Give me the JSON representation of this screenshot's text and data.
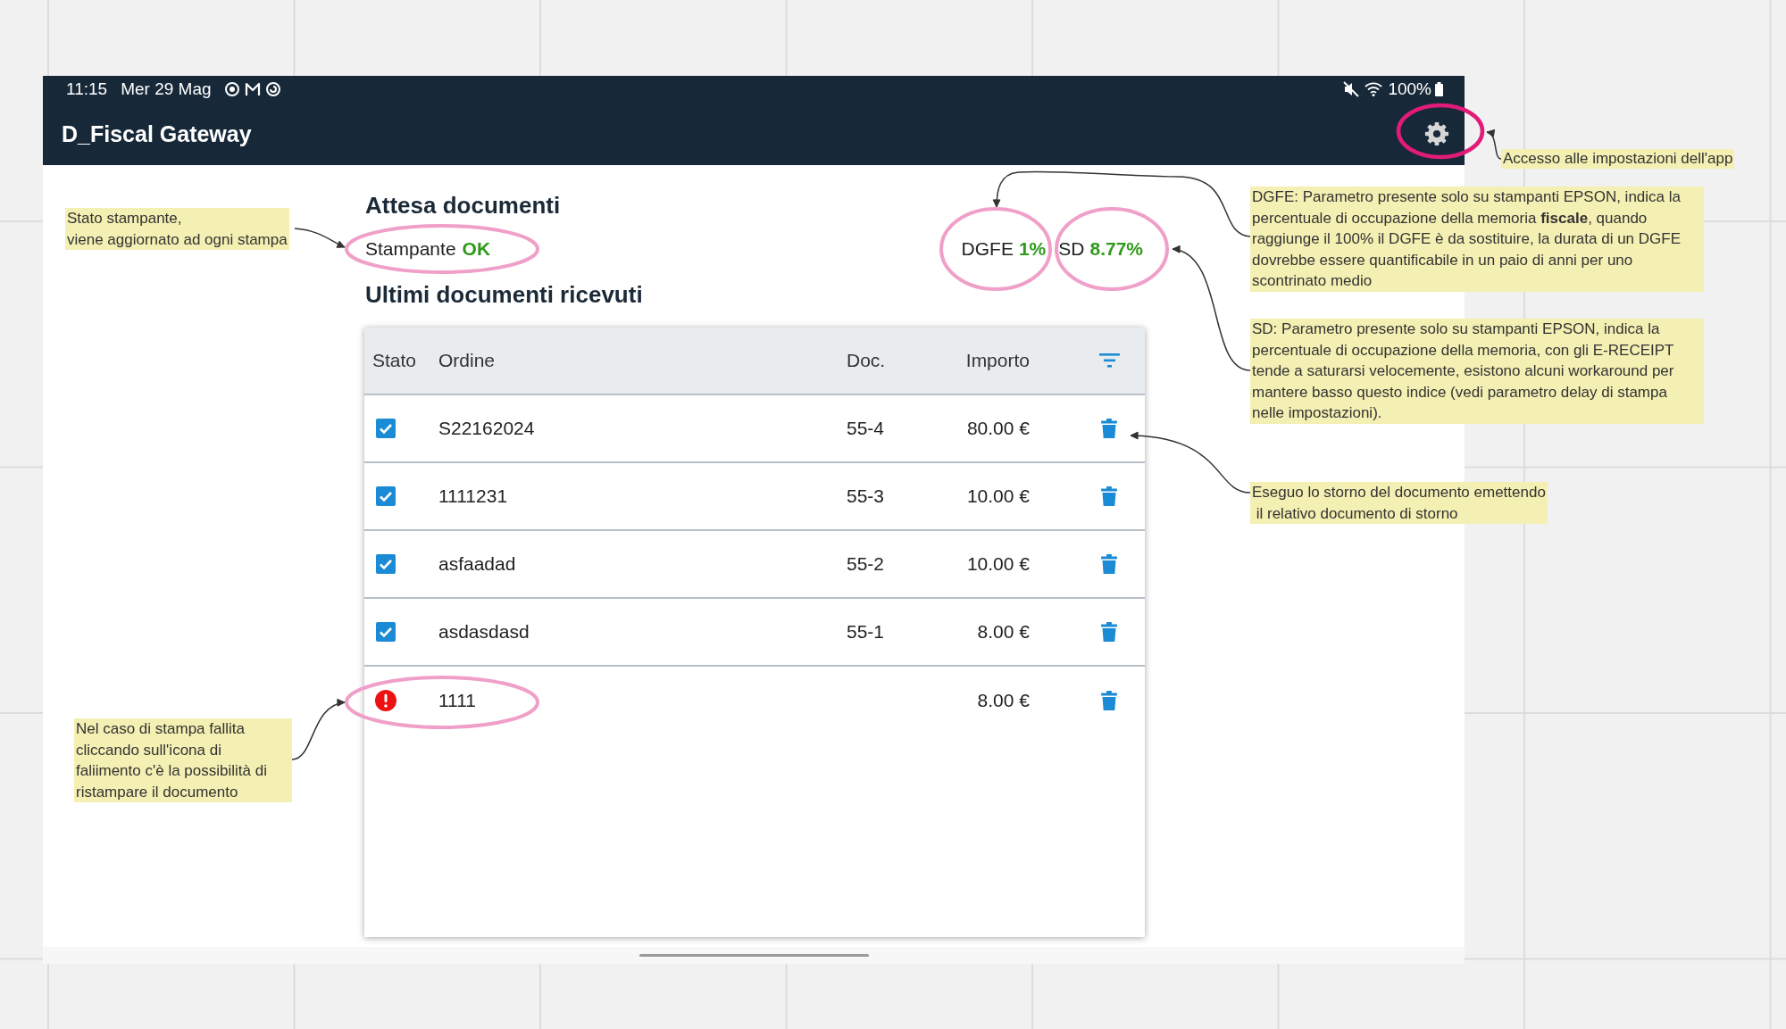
{
  "status_bar": {
    "time": "11:15",
    "date": "Mer 29 Mag",
    "battery": "100%"
  },
  "app_bar": {
    "title": "D_Fiscal Gateway"
  },
  "status_panel": {
    "heading": "Attesa documenti",
    "printer_label": "Stampante",
    "printer_status": "OK",
    "dgfe_label": "DGFE",
    "dgfe_value": "1%",
    "sd_label": "SD",
    "sd_value": "8.77%"
  },
  "documents": {
    "heading": "Ultimi documenti ricevuti",
    "columns": [
      "Stato",
      "Ordine",
      "Doc.",
      "Importo"
    ],
    "rows": [
      {
        "kind": "done",
        "order": "S22162024",
        "doc": "55-4",
        "amount": "80.00 €"
      },
      {
        "kind": "done",
        "order": "1111231",
        "doc": "55-3",
        "amount": "10.00 €"
      },
      {
        "kind": "done",
        "order": "asfaadad",
        "doc": "55-2",
        "amount": "10.00 €"
      },
      {
        "kind": "done",
        "order": "asdasdasd",
        "doc": "55-1",
        "amount": "8.00 €"
      },
      {
        "kind": "failed",
        "order": "1111",
        "amount": "8.00 €"
      }
    ]
  },
  "annotations": [
    {
      "text": "Accesso alle impostazioni dell'app"
    },
    {
      "text": "DGFE: Parametro presente solo su stampanti EPSON, indica la percentuale di occupazione della memoria **fiscale**, quando raggiunge il 100% il DGFE è da sostituire, la durata di un DGFE dovrebbe essere quantificabile in un paio di anni per uno scontrinato medio"
    },
    {
      "text": "Stato stampante,\nviene aggiornato ad ogni stampa"
    },
    {
      "text": "SD: Parametro presente solo su stampanti EPSON, indica la percentuale di occupazione della memoria, con gli E-RECEIPT tende a saturarsi velocemente, esistono alcuni workaround per mantere basso questo indice (vedi parametro delay di stampa nelle impostazioni)."
    },
    {
      "text": "Eseguo lo storno del documento emettendo\n il relativo documento di storno"
    },
    {
      "text": "Nel caso di stampa fallita cliccando sull'icona di faliimento c'è la possibilità di ristampare il documento"
    }
  ]
}
